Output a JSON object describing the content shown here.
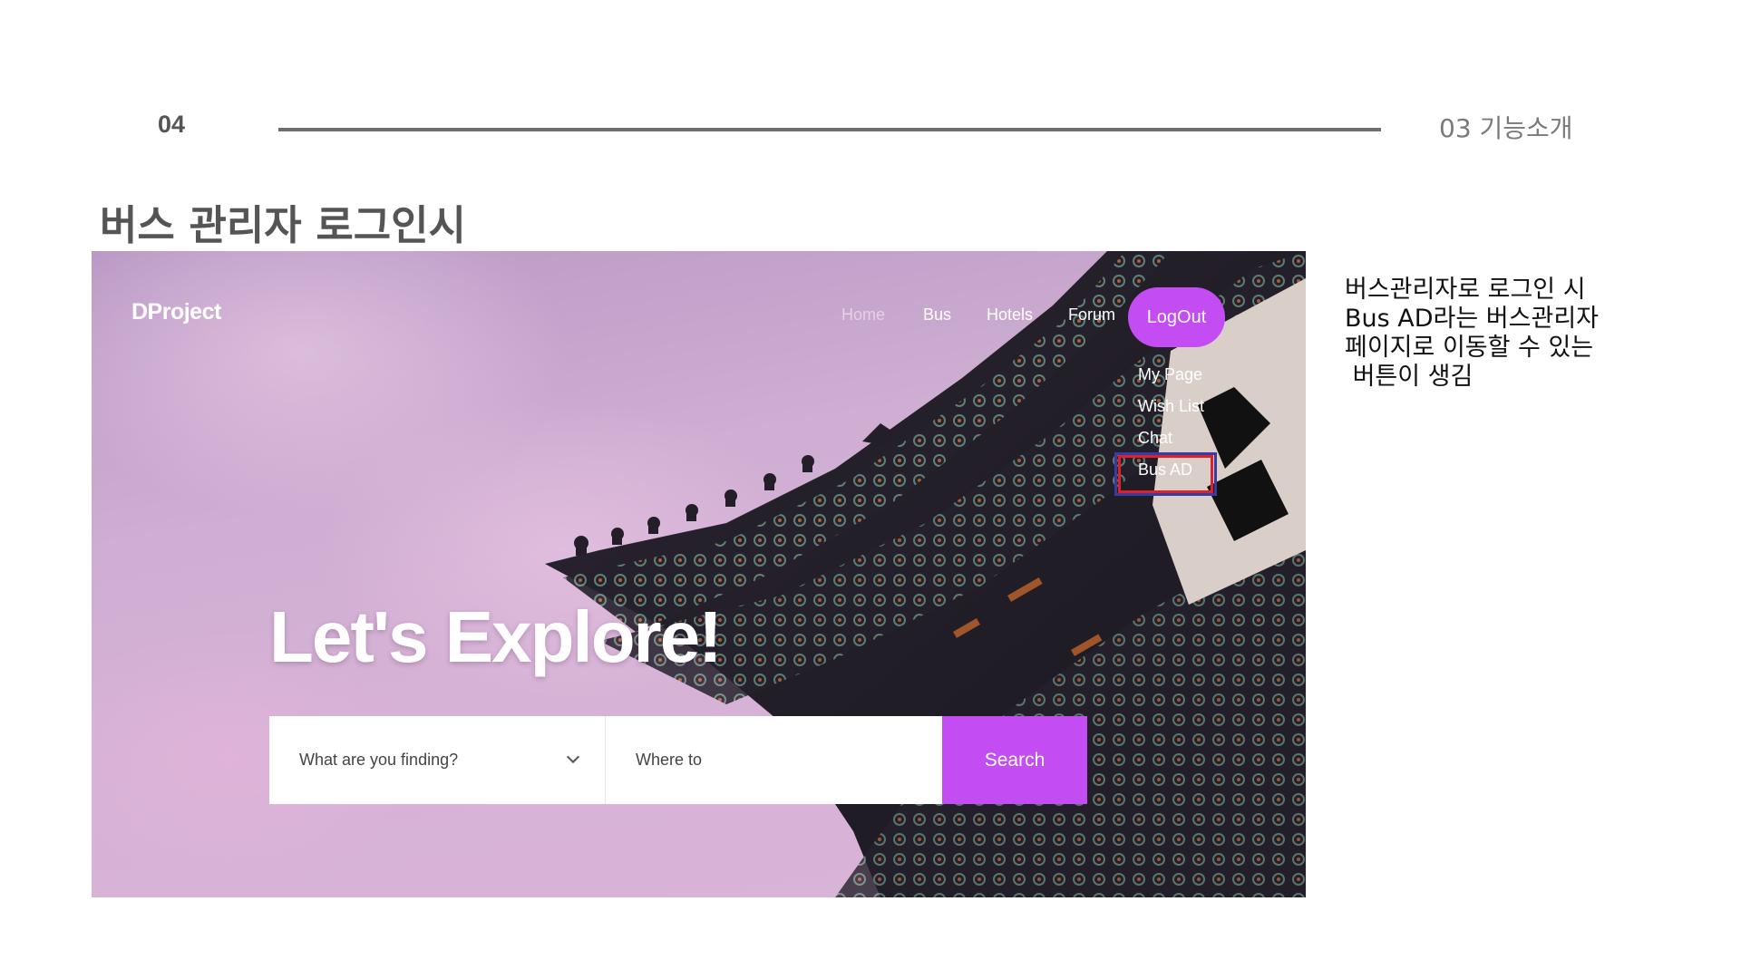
{
  "slide": {
    "page_number": "04",
    "section_label": "03 기능소개",
    "title": "버스 관리자 로그인시",
    "description_lines": [
      "버스관리자로 로그인 시",
      "Bus AD라는 버스관리자",
      "페이지로 이동할 수 있는",
      " 버튼이 생김"
    ]
  },
  "screenshot": {
    "logo": "DProject",
    "nav": [
      {
        "label": "Home",
        "active": true
      },
      {
        "label": "Bus"
      },
      {
        "label": "Hotels"
      },
      {
        "label": "Forum"
      }
    ],
    "logout_label": "LogOut",
    "dropdown": [
      "My Page",
      "Wish List",
      "Chat",
      "Bus AD"
    ],
    "highlighted_item": "Bus AD",
    "hero_text": "Let's Explore!",
    "search": {
      "category_placeholder": "What are you finding?",
      "where_placeholder": "Where to",
      "button_label": "Search"
    },
    "colors": {
      "accent": "#c34cf3",
      "highlight_outer": "#3a3aa0",
      "highlight_inner": "#d8222f"
    }
  }
}
